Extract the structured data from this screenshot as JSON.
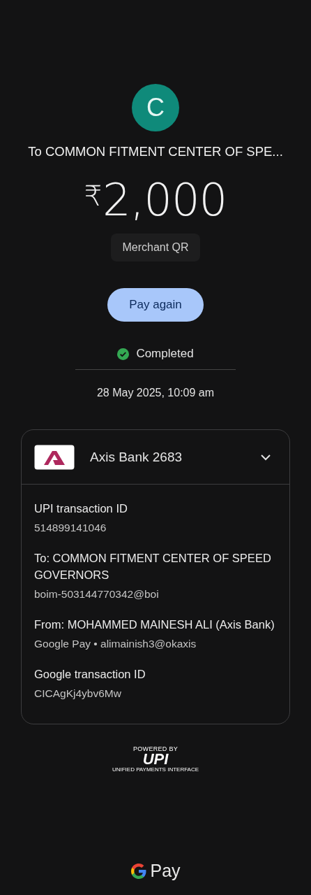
{
  "payee": {
    "avatar_letter": "C",
    "title": "To COMMON FITMENT CENTER OF SPE..."
  },
  "amount": {
    "currency": "₹",
    "value": "2,000"
  },
  "tag": "Merchant QR",
  "action_button": "Pay again",
  "status": {
    "kind": "success",
    "label": "Completed"
  },
  "timestamp": "28 May 2025, 10:09 am",
  "account_card": {
    "bank": "Axis Bank 2683",
    "details": [
      {
        "label": "UPI transaction ID",
        "value": "514899141046"
      },
      {
        "label": "To: COMMON FITMENT CENTER OF SPEED GOVERNORS",
        "value": "boim-503144770342@boi"
      },
      {
        "label": "From: MOHAMMED MAINESH ALI (Axis Bank)",
        "value": "Google Pay • alimainish3@okaxis"
      },
      {
        "label": "Google transaction ID",
        "value": "CICAgKj4ybv6Mw"
      }
    ]
  },
  "upi_badge": {
    "caption": "POWERED BY",
    "mark": "UPI",
    "subtitle": "UNIFIED PAYMENTS INTERFACE"
  },
  "footer_brand": "Pay"
}
